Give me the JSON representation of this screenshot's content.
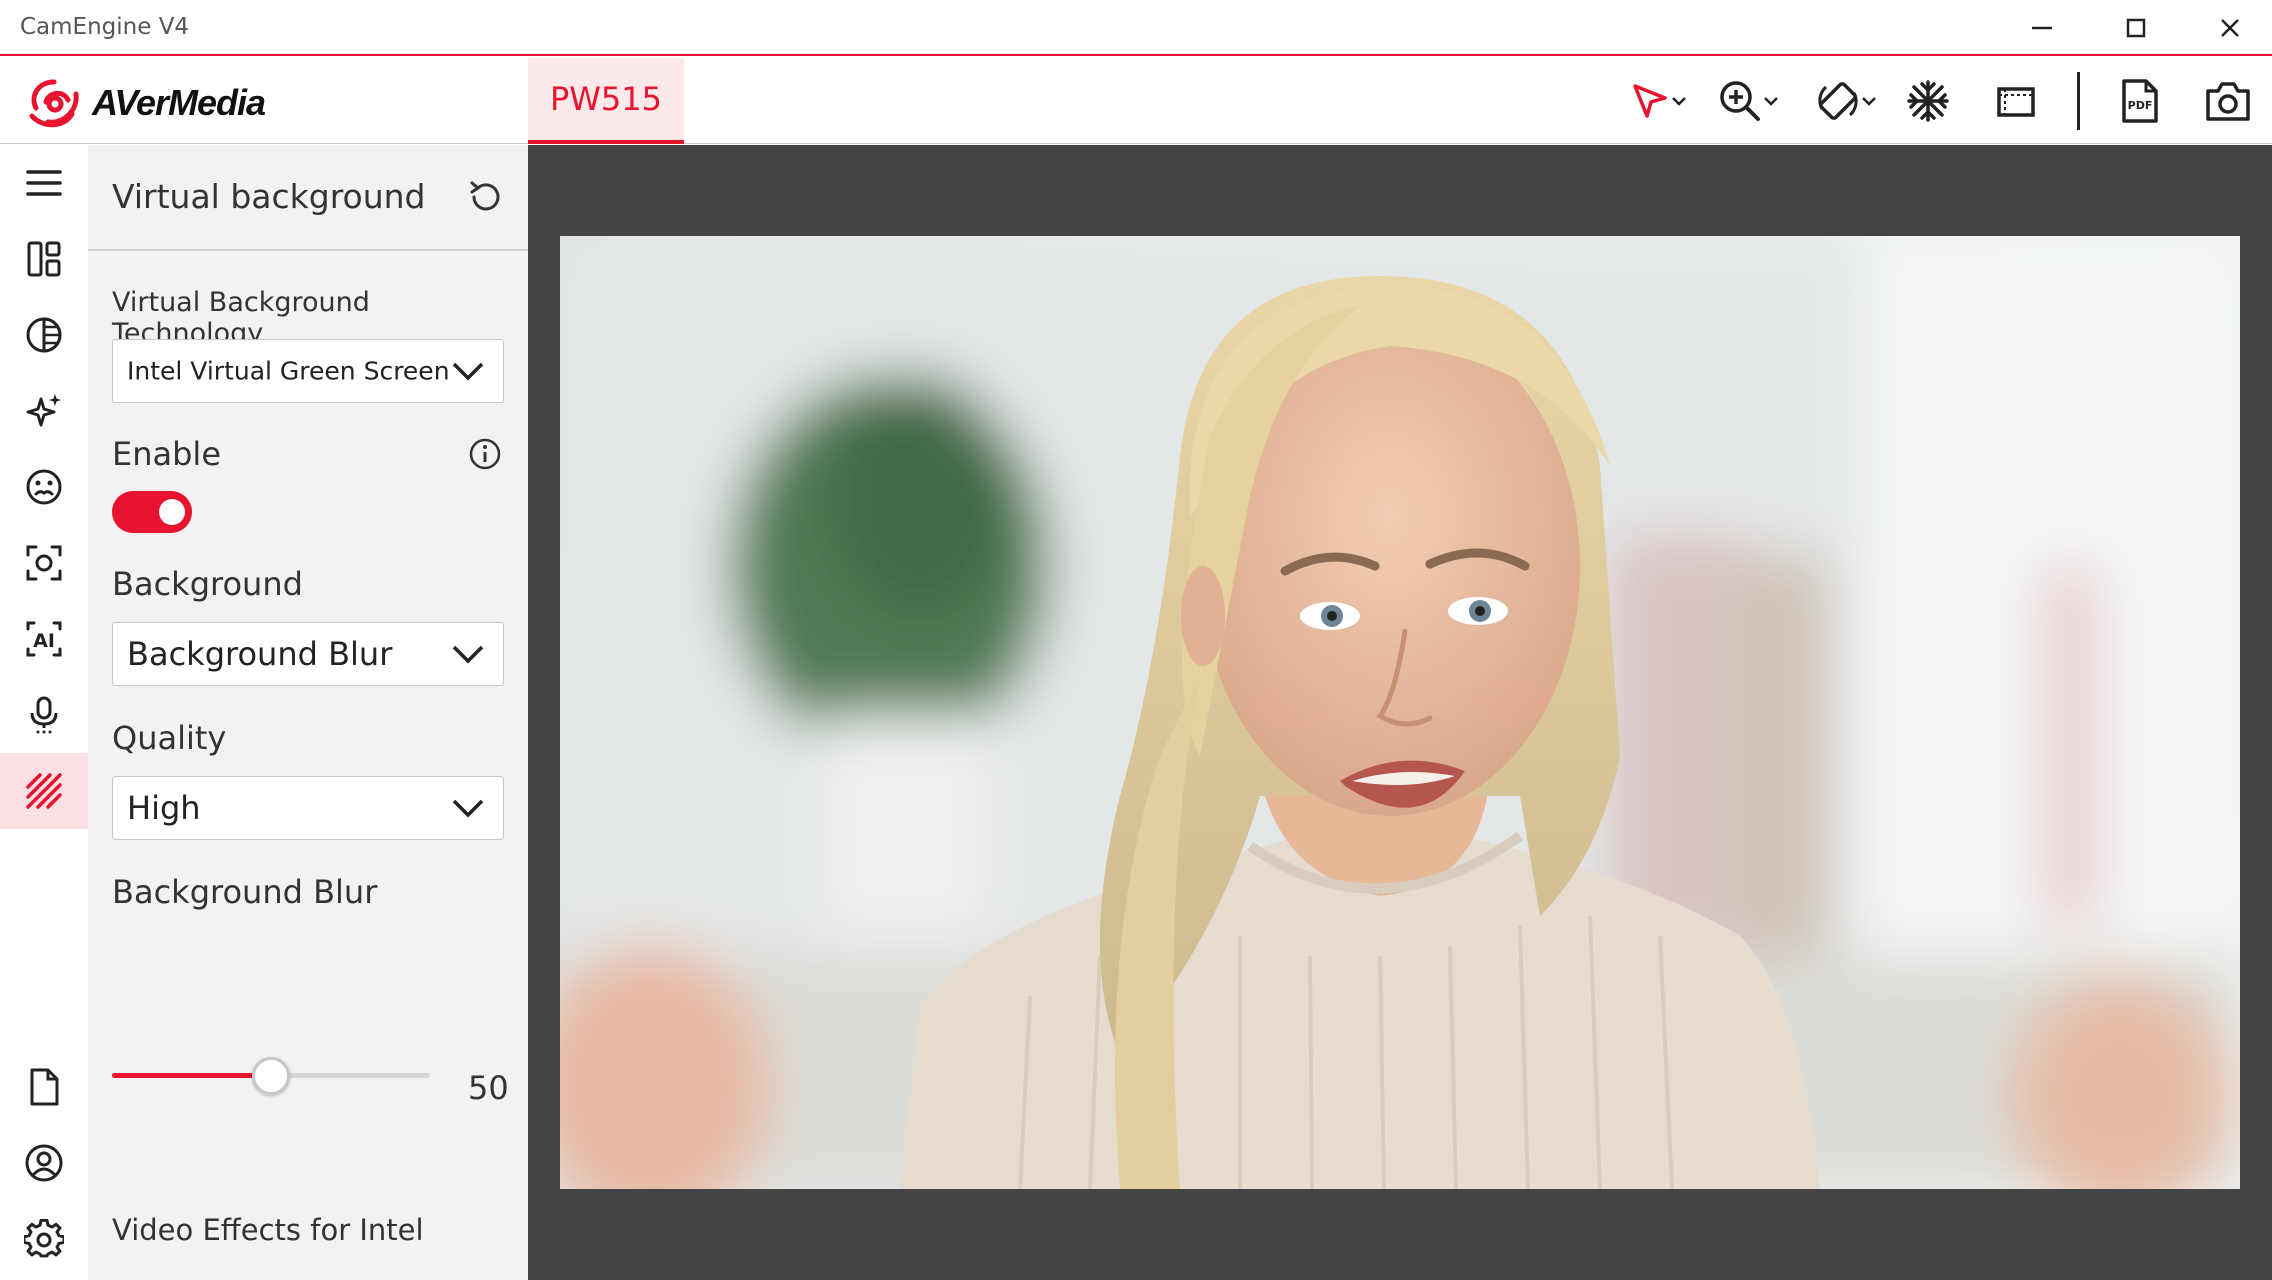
{
  "window": {
    "title": "CamEngine V4"
  },
  "brand": {
    "logo_text": "AVerMedia",
    "accent_color": "#e8132f"
  },
  "header": {
    "device_tab": "PW515",
    "toolbar": [
      {
        "name": "pointer-tool",
        "icon": "cursor-arrow-icon",
        "has_dropdown": true
      },
      {
        "name": "zoom-tool",
        "icon": "zoom-in-icon",
        "has_dropdown": true
      },
      {
        "name": "rotate-tool",
        "icon": "rotate-icon",
        "has_dropdown": true
      },
      {
        "name": "freeze-tool",
        "icon": "snowflake-icon",
        "has_dropdown": false
      },
      {
        "name": "crop-tool",
        "icon": "crop-frame-icon",
        "has_dropdown": false
      },
      {
        "name": "pdf-tool",
        "icon": "pdf-icon",
        "has_dropdown": false
      },
      {
        "name": "snapshot-tool",
        "icon": "camera-icon",
        "has_dropdown": false
      }
    ]
  },
  "sidebar": {
    "items": [
      {
        "name": "menu",
        "icon": "hamburger-icon"
      },
      {
        "name": "layout",
        "icon": "layout-icon"
      },
      {
        "name": "image-adjust",
        "icon": "contrast-icon"
      },
      {
        "name": "effects",
        "icon": "sparkle-icon"
      },
      {
        "name": "face",
        "icon": "face-icon"
      },
      {
        "name": "focus",
        "icon": "focus-icon"
      },
      {
        "name": "ai",
        "icon": "ai-icon"
      },
      {
        "name": "microphone",
        "icon": "microphone-icon"
      },
      {
        "name": "virtual-background",
        "icon": "stripes-icon",
        "active": true
      }
    ],
    "bottom_items": [
      {
        "name": "document",
        "icon": "document-icon"
      },
      {
        "name": "account",
        "icon": "user-circle-icon"
      },
      {
        "name": "settings",
        "icon": "gear-icon"
      }
    ]
  },
  "panel": {
    "title": "Virtual background",
    "technology_label": "Virtual Background Technology",
    "technology_value": "Intel Virtual Green Screen",
    "enable_label": "Enable",
    "enabled": true,
    "background_label": "Background",
    "background_value": "Background Blur",
    "quality_label": "Quality",
    "quality_value": "High",
    "blur_label": "Background Blur",
    "blur_value": "50",
    "blur_fraction": 0.5,
    "footer": "Video Effects for Intel"
  }
}
